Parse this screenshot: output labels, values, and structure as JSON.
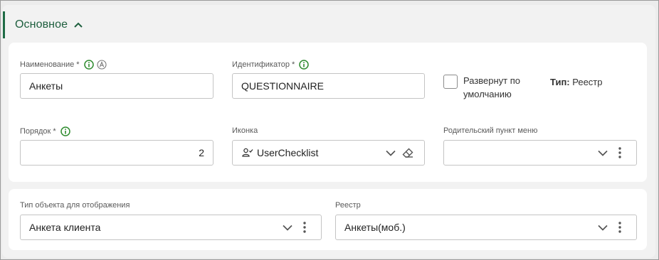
{
  "section": {
    "title": "Основное"
  },
  "fields": {
    "name": {
      "label": "Наименование",
      "required_mark": "*",
      "value": "Анкеты"
    },
    "identifier": {
      "label": "Идентификатор",
      "required_mark": "*",
      "value": "QUESTIONNAIRE"
    },
    "expanded_default": {
      "label": "Развернут по умолчанию",
      "checked": false
    },
    "type": {
      "label": "Тип:",
      "value": "Реестр"
    },
    "order": {
      "label": "Порядок",
      "required_mark": "*",
      "value": "2"
    },
    "icon": {
      "label": "Иконка",
      "value": "UserChecklist",
      "icon_name": "user-checklist-icon"
    },
    "parent_menu": {
      "label": "Родительский пункт меню",
      "value": ""
    },
    "object_type": {
      "label": "Тип объекта для отображения",
      "value": "Анкета клиента"
    },
    "registry": {
      "label": "Реестр",
      "value": "Анкеты(моб.)"
    }
  },
  "colors": {
    "accent": "#1e6b45",
    "info_icon": "#2e8b2e",
    "border": "#c4c4c4",
    "background": "#f2f2f2"
  },
  "icons": [
    "chevron-up-icon",
    "info-icon",
    "auto-icon",
    "user-checklist-icon",
    "chevron-down-icon",
    "eraser-icon",
    "more-vertical-icon"
  ]
}
